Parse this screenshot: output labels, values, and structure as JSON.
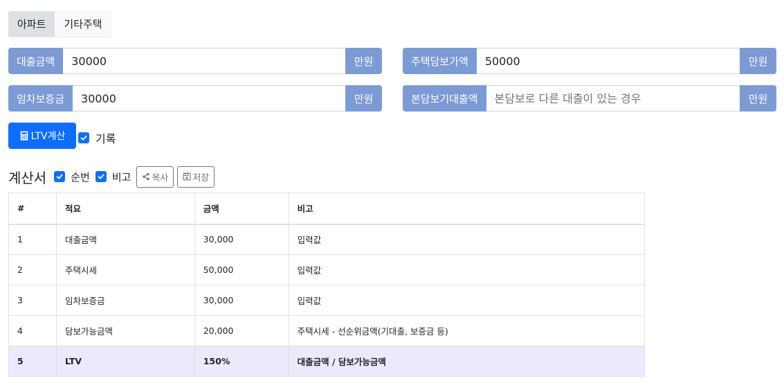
{
  "tabs": [
    "아파트",
    "기타주택"
  ],
  "form": {
    "loan": {
      "label": "대출금액",
      "value": "30000",
      "unit": "만원"
    },
    "house_value": {
      "label": "주택담보가액",
      "value": "50000",
      "unit": "만원"
    },
    "deposit": {
      "label": "임차보증금",
      "value": "30000",
      "unit": "만원"
    },
    "prior_loan": {
      "label": "본담보기대출액",
      "value": "",
      "placeholder": "본담보로 다른 대출이 있는 경우",
      "unit": "만원"
    }
  },
  "calc_button": "LTV계산",
  "record_label": "기록",
  "sheet": {
    "title": "계산서",
    "opt_seq": "순번",
    "opt_note": "비고",
    "copy_label": "복사",
    "save_label": "저장"
  },
  "table": {
    "headers": [
      "#",
      "적요",
      "금액",
      "비고"
    ],
    "rows": [
      [
        "1",
        "대출금액",
        "30,000",
        "입력값"
      ],
      [
        "2",
        "주택시세",
        "50,000",
        "입력값"
      ],
      [
        "3",
        "임차보증금",
        "30,000",
        "입력값"
      ],
      [
        "4",
        "담보가능금액",
        "20,000",
        "주택시세 - 선순위금액(기대출, 보증금 등)"
      ],
      [
        "5",
        "LTV",
        "150%",
        "대출금액 / 담보가능금액"
      ]
    ]
  },
  "colors": {
    "accent": "#7b9bd6",
    "primary": "#0d6efd",
    "highlight_row": "#eaeafa"
  }
}
